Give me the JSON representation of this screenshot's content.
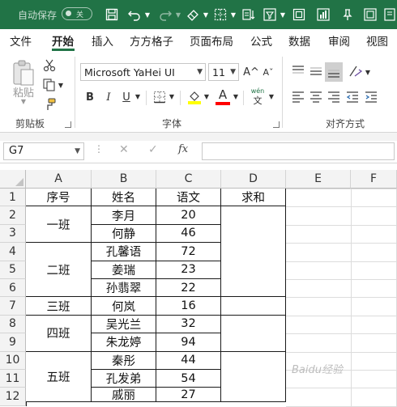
{
  "titlebar": {
    "autosave_label": "自动保存",
    "autosave_state": "关"
  },
  "tabs": [
    {
      "label": "文件"
    },
    {
      "label": "开始"
    },
    {
      "label": "插入"
    },
    {
      "label": "方方格子"
    },
    {
      "label": "页面布局"
    },
    {
      "label": "公式"
    },
    {
      "label": "数据"
    },
    {
      "label": "审阅"
    },
    {
      "label": "视图"
    }
  ],
  "ribbon": {
    "paste_label": "粘贴",
    "clipboard_label": "剪贴板",
    "font_name": "Microsoft YaHei UI",
    "font_size": "11",
    "font_group_label": "字体",
    "align_group_label": "对齐方式",
    "wen_label": "wén",
    "wen_char": "文",
    "grow_font": "A^",
    "shrink_font": "Aˇ",
    "bold": "B",
    "italic": "I",
    "underline": "U",
    "font_color_letter": "A",
    "colors": {
      "accent": "#217346",
      "highlight": "#ffff00",
      "font_color": "#ff0000"
    }
  },
  "formula_bar": {
    "name_box": "G7",
    "fx": "fx",
    "formula": ""
  },
  "sheet": {
    "columns": [
      "A",
      "B",
      "C",
      "D",
      "E",
      "F"
    ],
    "rows": [
      "1",
      "2",
      "3",
      "4",
      "5",
      "6",
      "7",
      "8",
      "9",
      "10",
      "11",
      "12"
    ],
    "headers": {
      "a": "序号",
      "b": "姓名",
      "c": "语文",
      "d": "求和"
    },
    "groups": [
      {
        "label": "一班"
      },
      {
        "label": "二班"
      },
      {
        "label": "三班"
      },
      {
        "label": "四班"
      },
      {
        "label": "五班"
      }
    ],
    "data": [
      {
        "name": "李月",
        "score": "20"
      },
      {
        "name": "何静",
        "score": "46"
      },
      {
        "name": "孔馨语",
        "score": "72"
      },
      {
        "name": "姜瑞",
        "score": "23"
      },
      {
        "name": "孙翡翠",
        "score": "22"
      },
      {
        "name": "何岚",
        "score": "16"
      },
      {
        "name": "吴光兰",
        "score": "32"
      },
      {
        "name": "朱龙婷",
        "score": "94"
      },
      {
        "name": "秦彤",
        "score": "44"
      },
      {
        "name": "孔发弟",
        "score": "54"
      },
      {
        "name": "戚丽",
        "score": "27"
      }
    ]
  },
  "watermark": "Baidu经验"
}
